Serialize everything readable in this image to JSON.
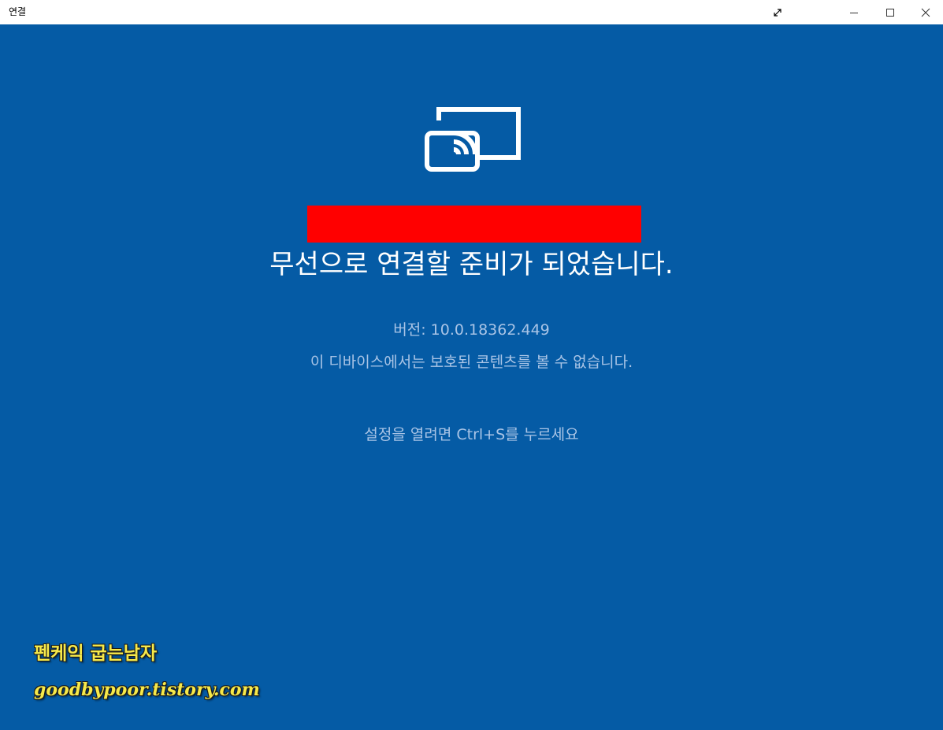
{
  "window": {
    "title": "연결",
    "background_color": "#055ba5",
    "controls": {
      "fullscreen_icon": "expand-diagonal-icon",
      "minimize_icon": "minimize-icon",
      "maximize_icon": "maximize-icon",
      "close_icon": "close-icon"
    }
  },
  "main": {
    "icon": "wireless-cast-icon",
    "redaction_color": "#ff0000",
    "headline": "무선으로 연결할 준비가 되었습니다.",
    "version": "버전: 10.0.18362.449",
    "protected_content_notice": "이 디바이스에서는 보호된 콘텐츠를 볼 수 없습니다.",
    "settings_hint": "설정을 열려면 Ctrl+S를 누르세요"
  },
  "watermark": {
    "name": "펜케익 굽는남자",
    "url": "goodbypoor.tistory.com",
    "color": "#f6e94a"
  }
}
